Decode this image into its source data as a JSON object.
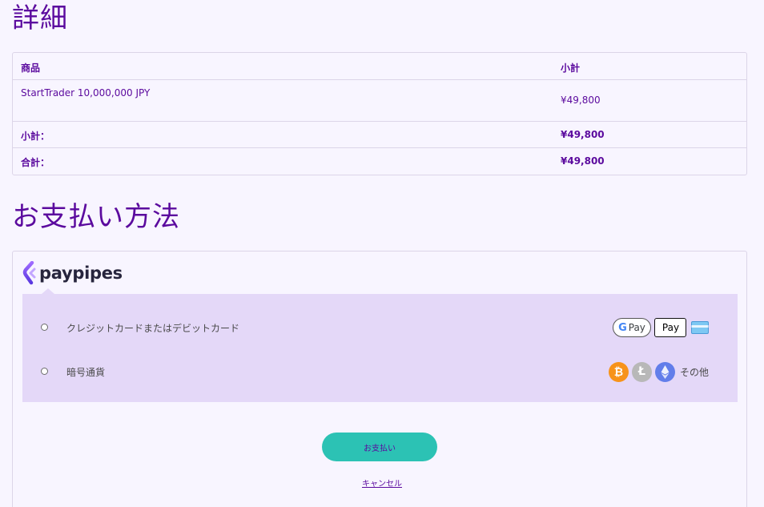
{
  "details": {
    "title": "詳細",
    "header": {
      "product": "商品",
      "subtotal": "小計"
    },
    "items": [
      {
        "name": "StartTrader 10,000,000 JPY",
        "price": "¥49,800"
      }
    ],
    "subtotal": {
      "label": "小計：",
      "value": "¥49,800"
    },
    "total": {
      "label": "合計：",
      "value": "¥49,800"
    }
  },
  "payment": {
    "title": "お支払い方法",
    "provider": "paypipes",
    "methods": [
      {
        "label": "クレジットカードまたはデビットカード",
        "badges": [
          "google-pay",
          "apple-pay",
          "credit-card"
        ]
      },
      {
        "label": "暗号通貨",
        "badges": [
          "bitcoin",
          "litecoin",
          "ethereum"
        ],
        "more": "その他"
      }
    ],
    "badge_text": {
      "gpay": "Pay",
      "gpay_g": "G",
      "apay": "Pay",
      "btc": "₿",
      "ltc": "Ł"
    },
    "pay_button": "お支払い",
    "cancel_link": "キャンセル"
  },
  "colors": {
    "accent": "#5b0a9e",
    "button": "#2cc2b4",
    "methods_bg": "#e4d8f8",
    "page_bg": "#f8f5ff"
  }
}
